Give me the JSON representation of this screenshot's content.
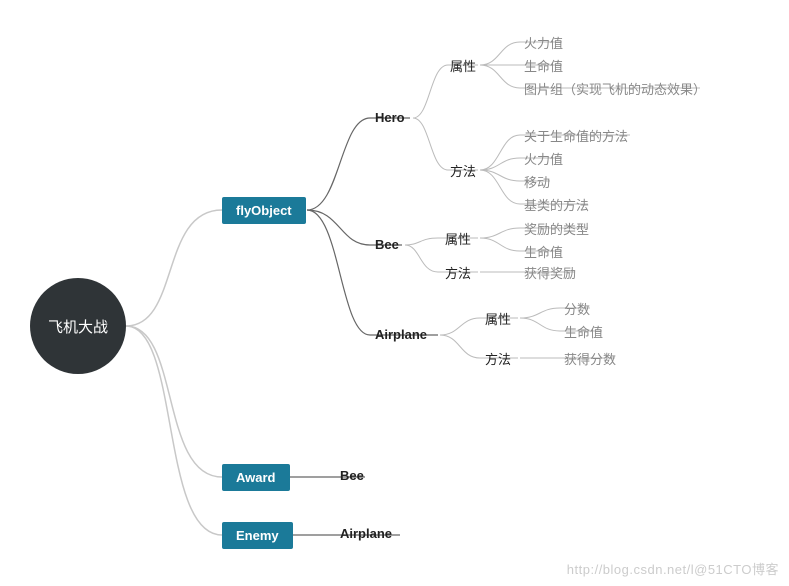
{
  "root": {
    "label": "飞机大战"
  },
  "level1": {
    "flyObject": "flyObject",
    "award": "Award",
    "enemy": "Enemy"
  },
  "flyObject_children": {
    "hero": "Hero",
    "bee": "Bee",
    "airplane": "Airplane"
  },
  "hero": {
    "attr_label": "属性",
    "method_label": "方法",
    "attrs": [
      "火力值",
      "生命值",
      "图片组（实现飞机的动态效果）"
    ],
    "methods": [
      "关于生命值的方法",
      "火力值",
      "移动",
      "基类的方法"
    ]
  },
  "bee": {
    "attr_label": "属性",
    "method_label": "方法",
    "attrs": [
      "奖励的类型",
      "生命值"
    ],
    "methods": [
      "获得奖励"
    ]
  },
  "airplane": {
    "attr_label": "属性",
    "method_label": "方法",
    "attrs": [
      "分数",
      "生命值"
    ],
    "methods": [
      "获得分数"
    ]
  },
  "award_children": {
    "bee": "Bee"
  },
  "enemy_children": {
    "airplane": "Airplane"
  },
  "watermark": "http://blog.csdn.net/l@51CTO博客"
}
